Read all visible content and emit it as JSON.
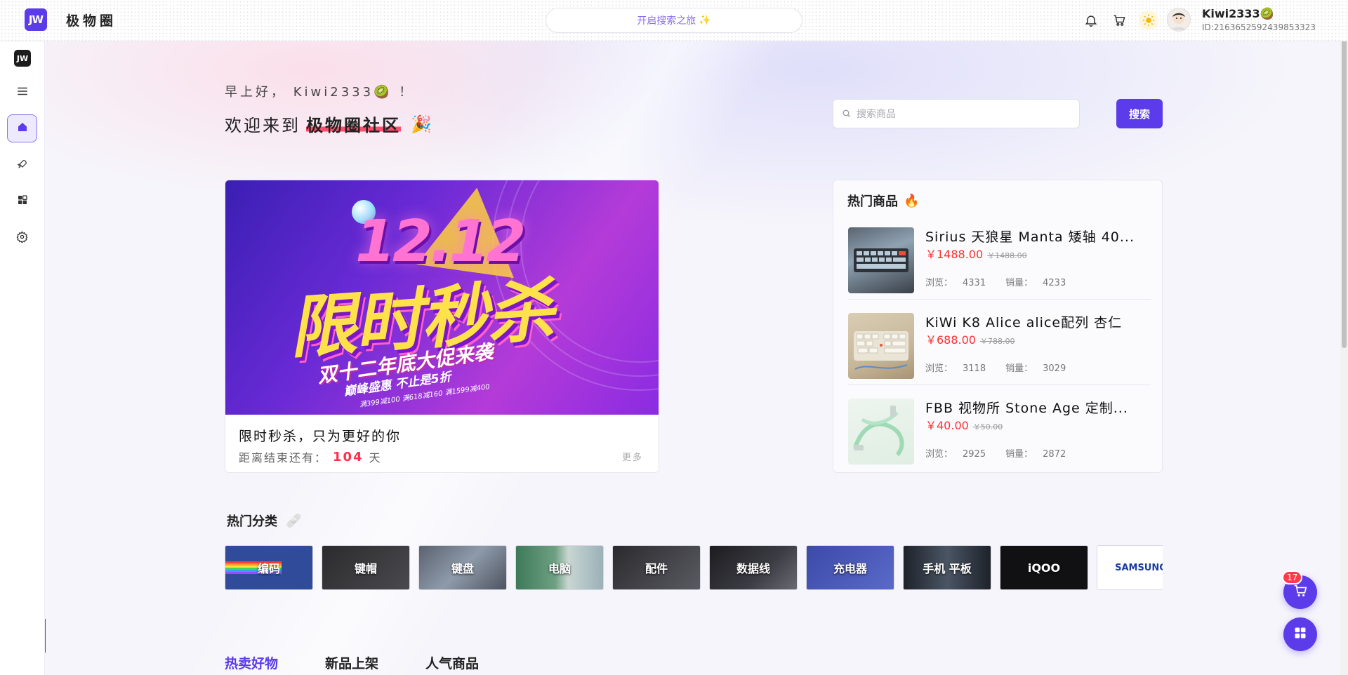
{
  "header": {
    "logo_text": "JW",
    "brand": "极物圈",
    "search_prompt": "开启搜索之旅",
    "search_prompt_emoji": "✨",
    "username": "Kiwi2333",
    "user_emoji": "🥝",
    "user_id": "ID:2163652592439853323"
  },
  "sidebar": {
    "logo_text": "JW",
    "items": [
      {
        "name": "menu",
        "icon": "hamburger-icon",
        "active": false
      },
      {
        "name": "home",
        "icon": "home-icon",
        "active": true
      },
      {
        "name": "discover",
        "icon": "rocket-icon",
        "active": false
      },
      {
        "name": "apps",
        "icon": "grid-icon",
        "active": false
      },
      {
        "name": "settings",
        "icon": "gear-icon",
        "active": false
      }
    ]
  },
  "hero": {
    "greeting": "早上好， Kiwi2333🥝 ！",
    "welcome_prefix": "欢迎来到",
    "welcome_highlight": "极物圈社区",
    "welcome_emoji": "🎉",
    "search_placeholder": "搜索商品",
    "search_button": "搜索"
  },
  "promo": {
    "banner_number": "12.12",
    "banner_headline": "限时秒杀",
    "banner_sub": "双十二年底大促来袭",
    "banner_sub2": "巅峰盛惠 不止是5折",
    "banner_sub3": "满399减100 满618减160 满1599减400",
    "title": "限时秒杀，只为更好的你",
    "countdown_prefix": "距离结束还有：",
    "countdown_days": "104",
    "countdown_unit": "天",
    "more": "更多"
  },
  "hot_goods": {
    "title": "热门商品",
    "title_emoji": "🔥",
    "views_label": "浏览：",
    "sales_label": "销量：",
    "items": [
      {
        "name": "Sirius 天狼星 Manta 矮轴 40...",
        "price": "￥1488.00",
        "old_price": "￥1488.00",
        "views": "4331",
        "sales": "4233"
      },
      {
        "name": "KiWi K8 Alice alice配列 杏仁",
        "price": "￥688.00",
        "old_price": "￥788.00",
        "views": "3118",
        "sales": "3029"
      },
      {
        "name": "FBB 视物所 Stone Age 定制...",
        "price": "￥40.00",
        "old_price": "￥50.00",
        "views": "2925",
        "sales": "2872"
      }
    ]
  },
  "categories": {
    "title": "热门分类",
    "title_emoji": "🩹",
    "items": [
      {
        "label": "编码",
        "bg": "#2f4b9a"
      },
      {
        "label": "键帽",
        "bg": "#3a3a3c"
      },
      {
        "label": "键盘",
        "bg": "#6e7686"
      },
      {
        "label": "电脑",
        "bg": "#4f7f6c"
      },
      {
        "label": "配件",
        "bg": "#3b3b40"
      },
      {
        "label": "数据线",
        "bg": "#2a2a2e"
      },
      {
        "label": "充电器",
        "bg": "#4a5ab0"
      },
      {
        "label": "手机 平板",
        "bg": "#2b2f38"
      },
      {
        "label": "iQOO",
        "bg": "#111114"
      },
      {
        "label": "SAMSUNG",
        "bg": "#ffffff"
      }
    ]
  },
  "tabs": [
    "热卖好物",
    "新品上架",
    "人气商品"
  ],
  "floating": {
    "cart_badge": "17"
  }
}
